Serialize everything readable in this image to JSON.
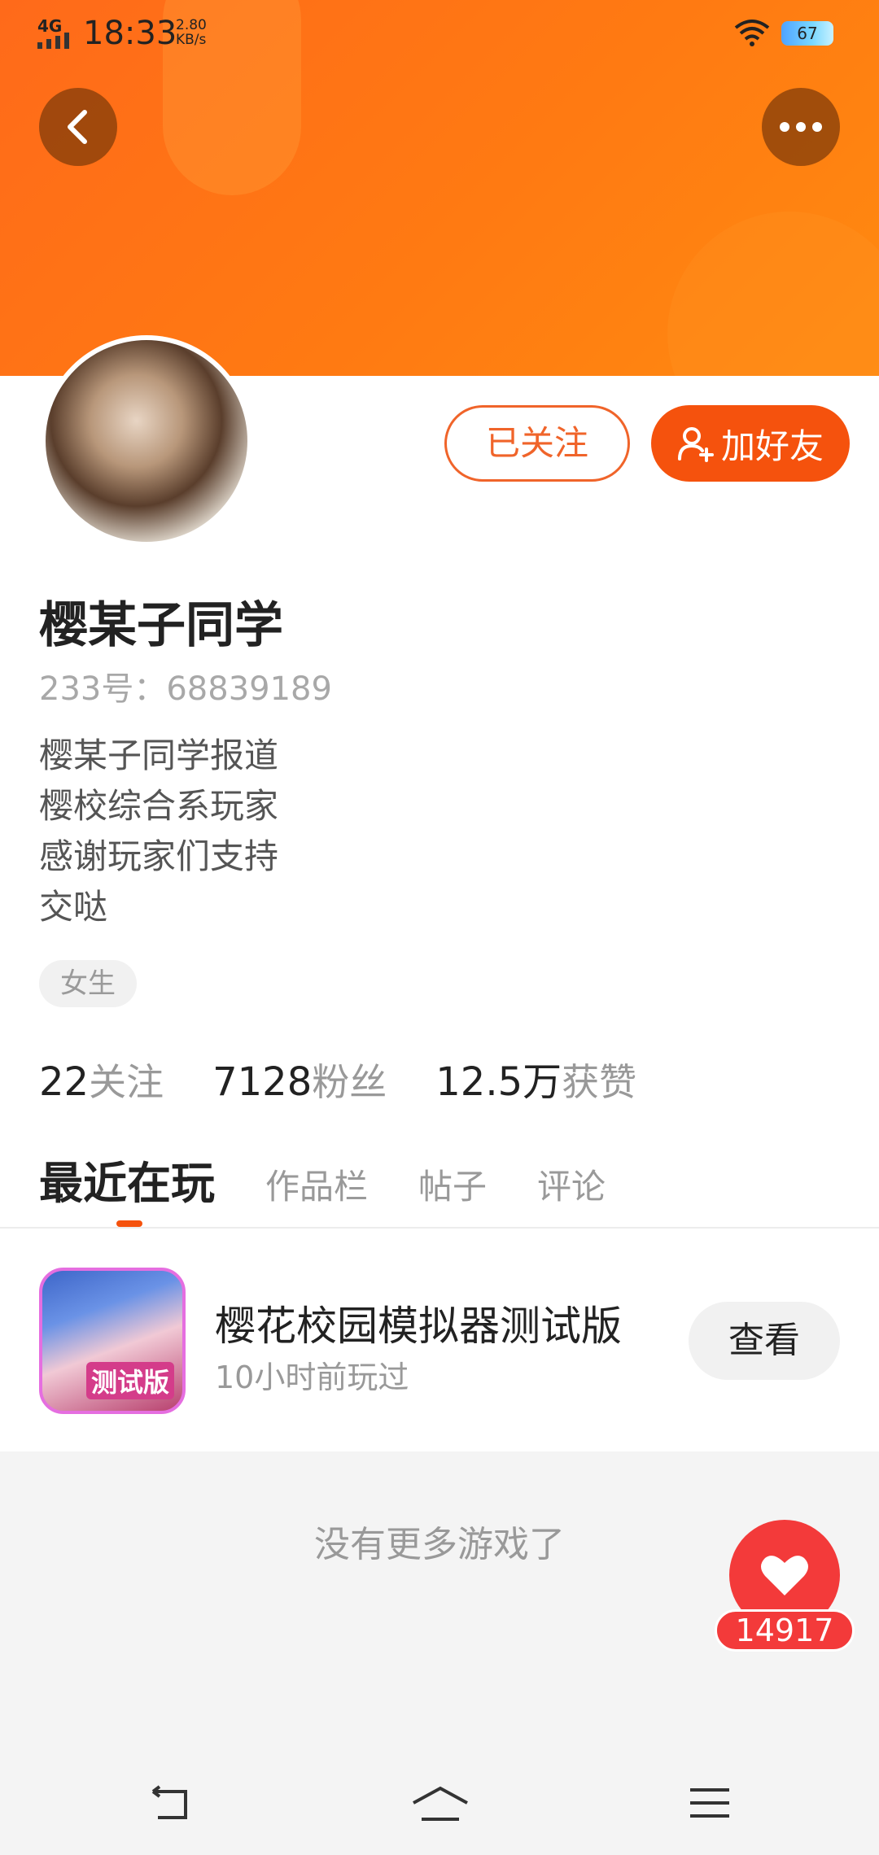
{
  "status_bar": {
    "network": "4G",
    "time": "18:33",
    "speed_value": "2.80",
    "speed_unit": "KB/s",
    "battery": "67"
  },
  "header": {
    "back_icon": "chevron-left-icon",
    "more_icon": "more-dots-icon"
  },
  "profile": {
    "follow_state_label": "已关注",
    "add_friend_label": "加好友",
    "name": "樱某子同学",
    "id_text": "233号：68839189",
    "bio": [
      "樱某子同学报道",
      "樱校综合系玩家",
      "感谢玩家们支持",
      "交哒"
    ],
    "gender_tag": "女生"
  },
  "stats": [
    {
      "value": "22",
      "label": "关注"
    },
    {
      "value": "7128",
      "label": "粉丝"
    },
    {
      "value": "12.5万",
      "label": "获赞"
    }
  ],
  "tabs": [
    {
      "label": "最近在玩",
      "active": true
    },
    {
      "label": "作品栏",
      "active": false
    },
    {
      "label": "帖子",
      "active": false
    },
    {
      "label": "评论",
      "active": false
    }
  ],
  "recent_game": {
    "icon_label": "测试版",
    "title": "樱花校园模拟器测试版",
    "subtitle": "10小时前玩过",
    "view_label": "查看"
  },
  "footer": {
    "no_more_text": "没有更多游戏了",
    "like_count": "14917"
  },
  "colors": {
    "accent": "#f5520d",
    "header_orange": "#ff7a12",
    "like_red": "#f33a3a"
  }
}
